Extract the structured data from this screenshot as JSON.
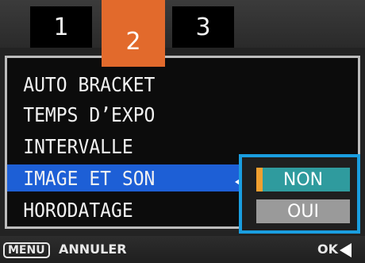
{
  "tabs": [
    {
      "label": "1",
      "active": false
    },
    {
      "label": "2",
      "active": true
    },
    {
      "label": "3",
      "active": false
    }
  ],
  "menu": {
    "items": [
      {
        "label": "AUTO BRACKET",
        "selected": false
      },
      {
        "label": "TEMPS D’EXPO",
        "selected": false
      },
      {
        "label": "INTERVALLE",
        "selected": false
      },
      {
        "label": "IMAGE ET SON",
        "selected": true
      },
      {
        "label": "HORODATAGE",
        "selected": false
      }
    ]
  },
  "options": {
    "items": [
      {
        "label": "NON",
        "selected": true
      },
      {
        "label": "OUI",
        "selected": false
      }
    ]
  },
  "footer": {
    "menu_key": "MENU",
    "cancel_label": "ANNULER",
    "ok_label": "OK"
  },
  "colors": {
    "active_tab": "#e26a2c",
    "selection": "#1d5fd6",
    "option_box_border": "#1a9ee0",
    "selected_option": "#2f9b9e",
    "unselected_option": "#9a9a9a"
  }
}
